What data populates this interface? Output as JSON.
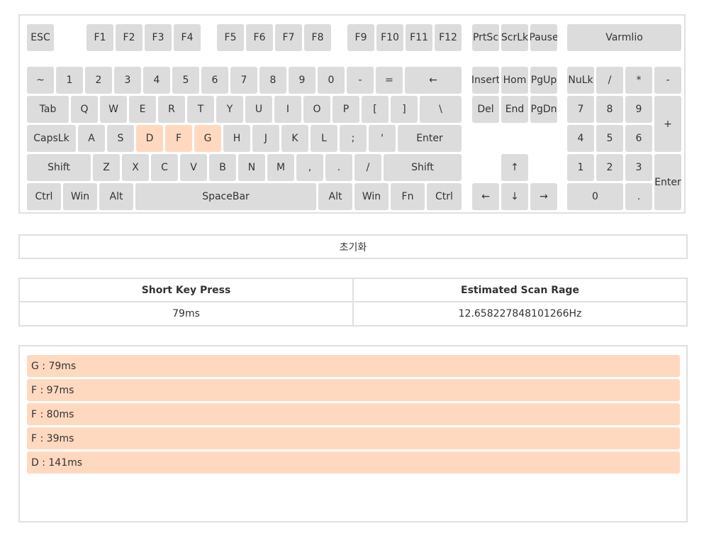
{
  "keyboard": {
    "function_row": [
      "ESC",
      "F1",
      "F2",
      "F3",
      "F4",
      "F5",
      "F6",
      "F7",
      "F8",
      "F9",
      "F10",
      "F11",
      "F12",
      "PrtSc",
      "ScrLk",
      "Pause",
      "Varmlio"
    ],
    "number_row": [
      "~",
      "1",
      "2",
      "3",
      "4",
      "5",
      "6",
      "7",
      "8",
      "9",
      "0",
      "-",
      "=",
      "←"
    ],
    "qwerty_row": [
      "Tab",
      "Q",
      "W",
      "E",
      "R",
      "T",
      "Y",
      "U",
      "I",
      "O",
      "P",
      "[",
      "]",
      "\\"
    ],
    "home_row": [
      "CapsLk",
      "A",
      "S",
      "D",
      "F",
      "G",
      "H",
      "J",
      "K",
      "L",
      ";",
      "'",
      "Enter"
    ],
    "shift_row": [
      "Shift",
      "Z",
      "X",
      "C",
      "V",
      "B",
      "N",
      "M",
      ",",
      ".",
      "/",
      "Shift"
    ],
    "bottom_row": [
      "Ctrl",
      "Win",
      "Alt",
      "SpaceBar",
      "Alt",
      "Win",
      "Fn",
      "Ctrl"
    ],
    "nav_block": [
      "Insert",
      "Hom",
      "PgUp",
      "Del",
      "End",
      "PgDn"
    ],
    "arrows": [
      "↑",
      "←",
      "↓",
      "→"
    ],
    "numpad": [
      "NuLk",
      "/",
      "*",
      "-",
      "7",
      "8",
      "9",
      "+",
      "4",
      "5",
      "6",
      "1",
      "2",
      "3",
      "Enter",
      "0",
      "."
    ],
    "highlighted_keys": [
      "D",
      "F",
      "G"
    ],
    "highlight_color": "#ffd9bf",
    "key_color": "#dcdcdc"
  },
  "reset_label": "초기화",
  "stats": {
    "col1_header": "Short Key Press",
    "col2_header": "Estimated Scan Rage",
    "col1_value": "79ms",
    "col2_value": "12.658227848101266Hz"
  },
  "log": [
    {
      "text": "G : 79ms"
    },
    {
      "text": "F : 97ms"
    },
    {
      "text": "F : 80ms"
    },
    {
      "text": "F : 39ms"
    },
    {
      "text": "D : 141ms"
    }
  ]
}
